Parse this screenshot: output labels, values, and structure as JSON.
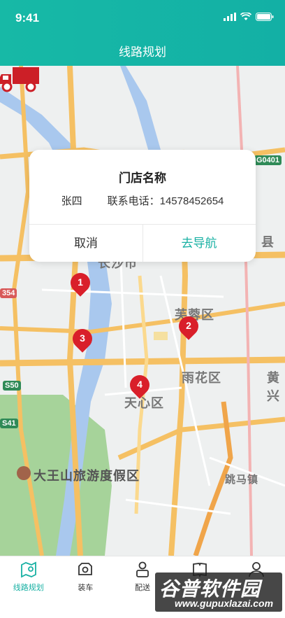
{
  "status_bar": {
    "time": "9:41"
  },
  "header": {
    "title": "线路规划"
  },
  "map": {
    "labels": {
      "furong": "芙蓉区",
      "yuhua": "雨花区",
      "tianxin": "天心区",
      "huang": "黄兴",
      "dawangshan": "大王山旅游度假区",
      "tiaomazhen": "跳马镇",
      "xian": "县",
      "changsha": "长沙市"
    },
    "shields": {
      "g0401": "G0401",
      "s354": "354",
      "s50": "S50",
      "s41": "S41"
    },
    "markers": [
      {
        "num": "1"
      },
      {
        "num": "2"
      },
      {
        "num": "3"
      },
      {
        "num": "4"
      }
    ]
  },
  "popup": {
    "store_name": "门店名称",
    "contact_name": "张四",
    "phone_label": "联系电话：14578452654",
    "cancel_label": "取消",
    "navigate_label": "去导航"
  },
  "tabbar": {
    "tabs": [
      {
        "label": "线路规划",
        "icon": "map-pin-icon"
      },
      {
        "label": "装车",
        "icon": "truck-load-icon"
      },
      {
        "label": "配送",
        "icon": "courier-icon"
      },
      {
        "label": "",
        "icon": "book-icon"
      },
      {
        "label": "",
        "icon": "user-icon"
      }
    ]
  },
  "watermark": {
    "brand": "谷普软件园",
    "url": "www.gupuxlazai.com"
  },
  "colors": {
    "accent": "#17b0a3",
    "marker": "#d91f2a",
    "truck": "#cc1f27"
  }
}
